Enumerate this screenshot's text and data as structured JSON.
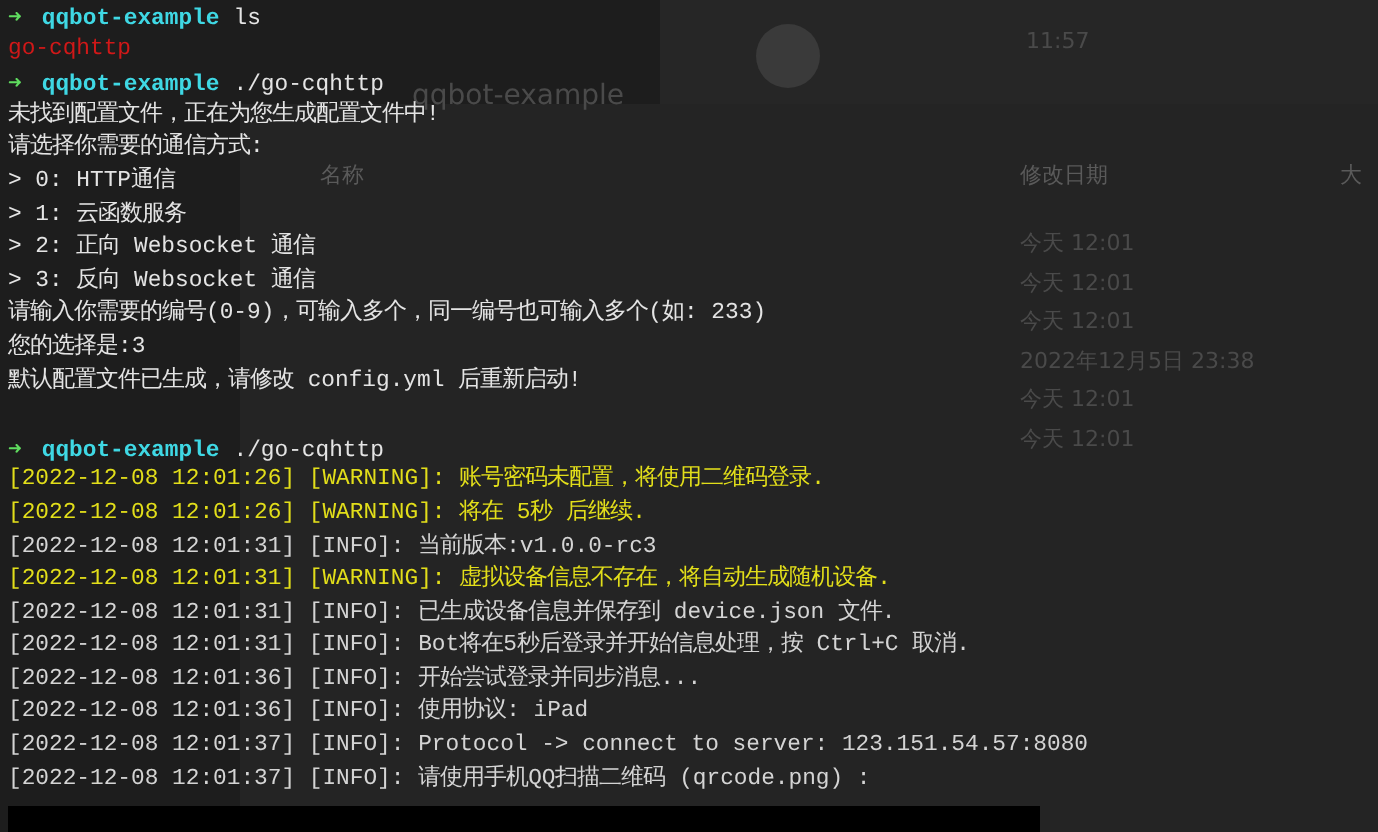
{
  "background": {
    "chat_time": "11:57",
    "finder": {
      "title": "qqbot-example",
      "columns": [
        "名称",
        "修改日期",
        "大"
      ],
      "dates": [
        "今天 12:01",
        "今天 12:01",
        "今天 12:01",
        "2022年12月5日 23:38",
        "今天 12:01",
        "今天 12:01"
      ]
    }
  },
  "terminal": {
    "lines": [
      {
        "kind": "prompt",
        "arrow": "➜",
        "dir": "qqbot-example",
        "command": "ls"
      },
      {
        "kind": "error",
        "text": "go-cqhttp"
      },
      {
        "kind": "prompt",
        "arrow": "➜",
        "dir": "qqbot-example",
        "command": "./go-cqhttp"
      },
      {
        "kind": "plain",
        "text": "未找到配置文件，正在为您生成配置文件中!"
      },
      {
        "kind": "plain",
        "text": "请选择你需要的通信方式:"
      },
      {
        "kind": "plain",
        "text": "> 0: HTTP通信"
      },
      {
        "kind": "plain",
        "text": "> 1: 云函数服务"
      },
      {
        "kind": "plain",
        "text": "> 2: 正向 Websocket 通信"
      },
      {
        "kind": "plain",
        "text": "> 3: 反向 Websocket 通信"
      },
      {
        "kind": "plain",
        "text": "请输入你需要的编号(0-9)，可输入多个，同一编号也可输入多个(如: 233)"
      },
      {
        "kind": "plain",
        "text": "您的选择是:3"
      },
      {
        "kind": "plain",
        "text": "默认配置文件已生成，请修改 config.yml 后重新启动!"
      },
      {
        "kind": "blank"
      },
      {
        "kind": "prompt",
        "arrow": "➜",
        "dir": "qqbot-example",
        "command": "./go-cqhttp"
      },
      {
        "kind": "warning",
        "text": "[2022-12-08 12:01:26] [WARNING]: 账号密码未配置，将使用二维码登录."
      },
      {
        "kind": "warning",
        "text": "[2022-12-08 12:01:26] [WARNING]: 将在 5秒 后继续."
      },
      {
        "kind": "info",
        "text": "[2022-12-08 12:01:31] [INFO]: 当前版本:v1.0.0-rc3"
      },
      {
        "kind": "warning",
        "text": "[2022-12-08 12:01:31] [WARNING]: 虚拟设备信息不存在，将自动生成随机设备."
      },
      {
        "kind": "info",
        "text": "[2022-12-08 12:01:31] [INFO]: 已生成设备信息并保存到 device.json 文件."
      },
      {
        "kind": "info",
        "text": "[2022-12-08 12:01:31] [INFO]: Bot将在5秒后登录并开始信息处理，按 Ctrl+C 取消."
      },
      {
        "kind": "info",
        "text": "[2022-12-08 12:01:36] [INFO]: 开始尝试登录并同步消息..."
      },
      {
        "kind": "info",
        "text": "[2022-12-08 12:01:36] [INFO]: 使用协议: iPad"
      },
      {
        "kind": "info",
        "text": "[2022-12-08 12:01:37] [INFO]: Protocol -> connect to server: 123.151.54.57:8080"
      },
      {
        "kind": "info",
        "text": "[2022-12-08 12:01:37] [INFO]: 请使用手机QQ扫描二维码 (qrcode.png) :"
      }
    ]
  }
}
